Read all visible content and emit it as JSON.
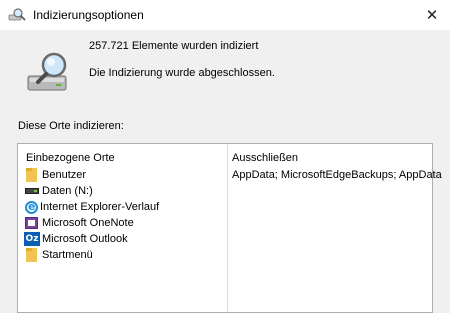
{
  "window": {
    "title": "Indizierungsoptionen",
    "close_glyph": "✕"
  },
  "status": {
    "count_text": "257.721 Elemente wurden indiziert",
    "message": "Die Indizierung wurde abgeschlossen."
  },
  "locations": {
    "section_label": "Diese Orte indizieren:",
    "included_header": "Einbezogene Orte",
    "excluded_header": "Ausschließen",
    "excluded_text": "AppData; MicrosoftEdgeBackups; AppData",
    "items": [
      {
        "label": "Benutzer",
        "icon": "folder-icon"
      },
      {
        "label": "Daten (N:)",
        "icon": "drive-icon"
      },
      {
        "label": "Internet Explorer-Verlauf",
        "icon": "internet-explorer-icon"
      },
      {
        "label": "Microsoft OneNote",
        "icon": "onenote-icon"
      },
      {
        "label": "Microsoft Outlook",
        "icon": "outlook-icon"
      },
      {
        "label": "Startmenü",
        "icon": "folder-icon"
      }
    ]
  }
}
